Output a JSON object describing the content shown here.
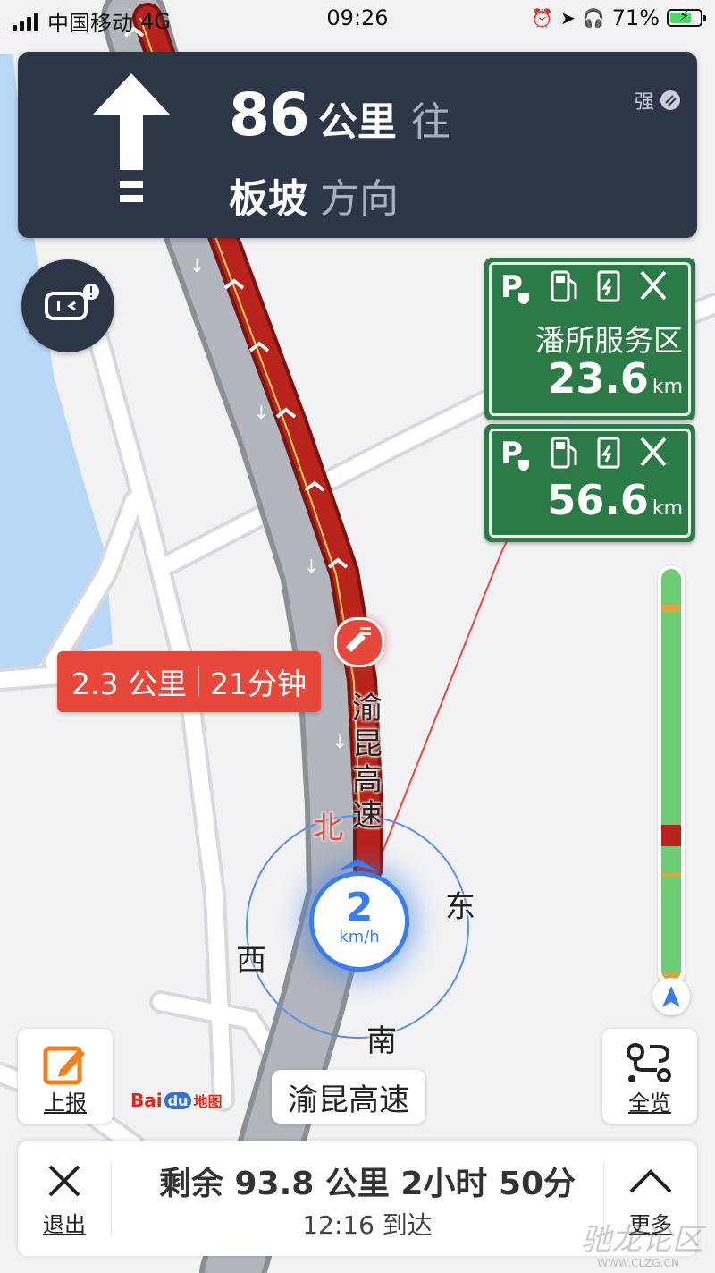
{
  "status_bar": {
    "carrier": "中国移动",
    "network": "4G",
    "time": "09:26",
    "battery_percent": "71%",
    "battery_level": 0.71
  },
  "nav_banner": {
    "distance_value": "86",
    "distance_unit": "公里",
    "direction_word": "往",
    "road_name": "板坡",
    "road_suffix": "方向",
    "gps_strength": "强",
    "turn_icon": "straight-arrow-icon"
  },
  "service_areas": [
    {
      "name": "潘所服务区",
      "distance": "23.6",
      "unit": "km",
      "icons": [
        "parking-icon",
        "gas-pump-icon",
        "ev-charger-icon",
        "restaurant-icon"
      ]
    },
    {
      "name": "",
      "distance": "56.6",
      "unit": "km",
      "icons": [
        "parking-icon",
        "gas-pump-icon",
        "ev-charger-icon",
        "restaurant-icon"
      ]
    }
  ],
  "traffic": {
    "distance": "2.3 公里",
    "time": "21分钟"
  },
  "road_label_vertical": "渝昆高速",
  "compass": {
    "north": "北",
    "east": "东",
    "west": "西",
    "south": "南"
  },
  "speed": {
    "value": "2",
    "unit": "km/h"
  },
  "tools": {
    "report_label": "上报",
    "overview_label": "全览"
  },
  "logo": {
    "bai": "Bai",
    "du": "du",
    "map": "地图"
  },
  "current_road": "渝昆高速",
  "bottom": {
    "remaining": "剩余 93.8 公里 2小时 50分",
    "arrival": "12:16 到达",
    "exit_label": "退出",
    "more_label": "更多"
  },
  "watermark": {
    "text": "驰龙论区",
    "url": "WWW.CLZG.CN"
  },
  "colors": {
    "banner_bg": "#2d3647",
    "route_red": "#b8231b",
    "traffic_red": "#e8473c",
    "service_green": "#2c7a45",
    "speed_blue": "#3a7df0",
    "progress_green": "#6fcb74"
  }
}
